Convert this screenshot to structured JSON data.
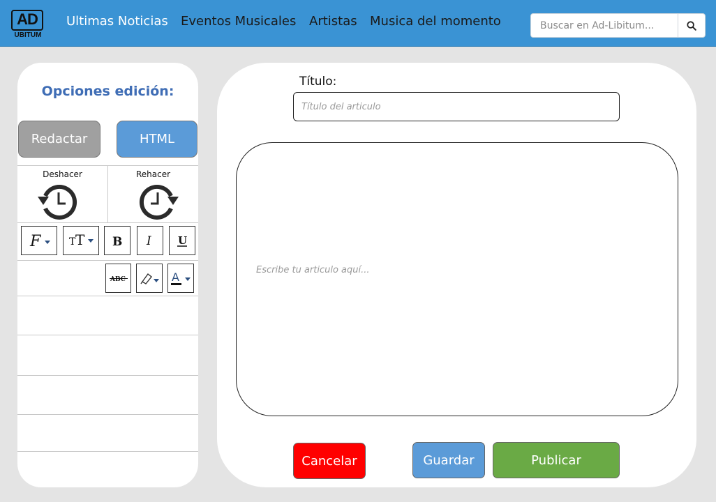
{
  "header": {
    "logo": {
      "main": "AD",
      "sub": "UBITUM"
    },
    "nav": [
      {
        "label": "Ultimas Noticias",
        "active": true
      },
      {
        "label": "Eventos Musicales",
        "active": false
      },
      {
        "label": "Artistas",
        "active": false
      },
      {
        "label": "Musica del momento",
        "active": false
      }
    ],
    "search": {
      "placeholder": "Buscar en Ad-Libitum...",
      "value": "",
      "icon": "search-icon"
    }
  },
  "sidebar": {
    "title": "Opciones edición:",
    "modes": {
      "write_label": "Redactar",
      "html_label": "HTML"
    },
    "history": {
      "undo_label": "Deshacer",
      "undo_icon": "undo-icon",
      "redo_label": "Rehacer",
      "redo_icon": "redo-icon"
    },
    "tools": [
      {
        "name": "font-family",
        "icon": "font-family-icon"
      },
      {
        "name": "font-size",
        "icon": "font-size-icon"
      },
      {
        "name": "bold",
        "icon": "bold-icon"
      },
      {
        "name": "italic",
        "icon": "italic-icon"
      },
      {
        "name": "underline",
        "icon": "underline-icon"
      },
      {
        "name": "strikethrough",
        "icon": "strikethrough-icon"
      },
      {
        "name": "highlight",
        "icon": "highlight-icon"
      },
      {
        "name": "text-color",
        "icon": "text-color-icon"
      }
    ]
  },
  "editor": {
    "title_label": "Título:",
    "title_placeholder": "Título del articulo",
    "title_value": "",
    "body_placeholder": "Escribe tu articulo aquí...",
    "body_value": "",
    "actions": {
      "cancel": "Cancelar",
      "save": "Guardar",
      "publish": "Publicar"
    }
  },
  "colors": {
    "header_bg": "#3a93d4",
    "section_title": "#3f6db5",
    "html_button": "#5b9bd8",
    "redactar_button": "#a0a0a0",
    "cancel": "#ff0000",
    "save": "#5b9bd8",
    "publish": "#6aaa45",
    "page_bg": "#e4e4e4"
  }
}
